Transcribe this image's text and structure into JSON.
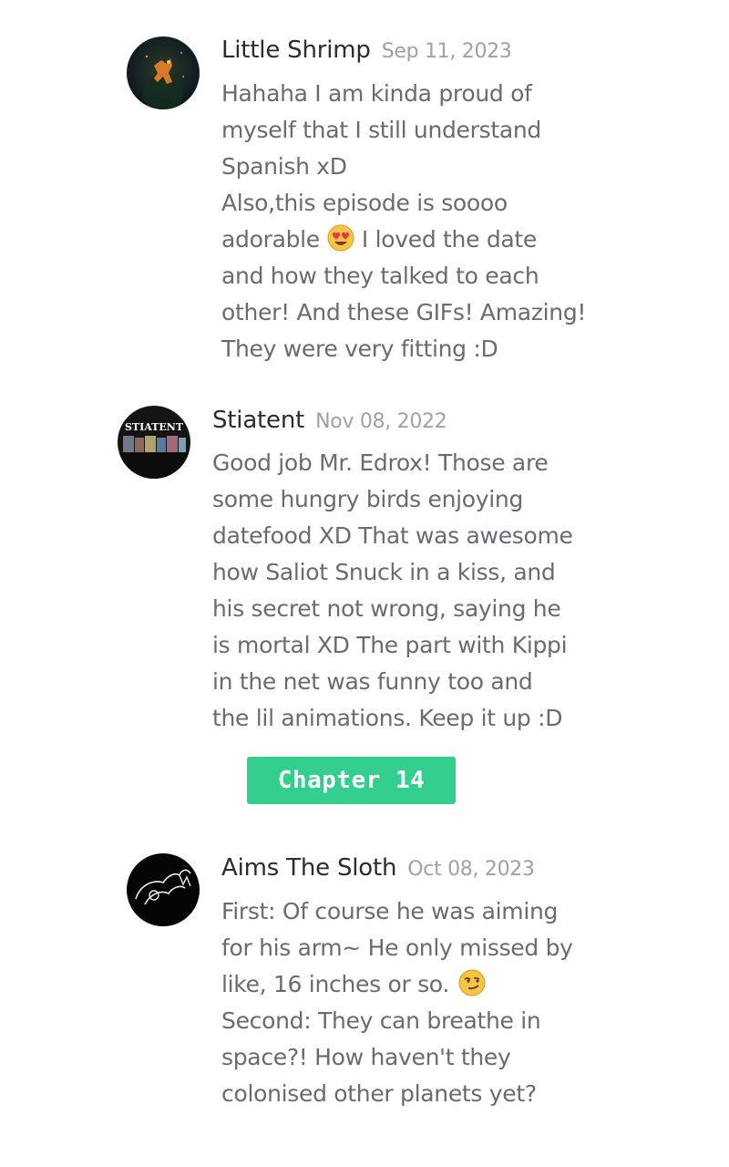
{
  "comments": [
    {
      "username": "Little Shrimp",
      "date": "Sep 11, 2023",
      "avatar_icon": "shrimp-avatar",
      "lines": [
        "Hahaha I am kinda proud of",
        "myself that I still understand",
        "Spanish xD",
        "Also,this episode is soooo",
        "adorable",
        "I loved the date",
        "and how they talked to each",
        "other! And these GIFs! Amazing!",
        "They were very fitting :D"
      ],
      "emoji": "heart-eyes-emoji"
    },
    {
      "username": "Stiatent",
      "date": "Nov 08, 2022",
      "avatar_text": "STIATENT",
      "lines": [
        "Good job Mr. Edrox! Those are",
        "some hungry birds enjoying",
        "datefood XD That was awesome",
        "how Saliot Snuck in a kiss, and",
        "his secret not wrong, saying he",
        "is mortal XD The part with Kippi",
        "in the net was funny too and",
        "the lil animations. Keep it up :D"
      ]
    },
    {
      "username": "Aims The Sloth",
      "date": "Oct 08, 2023",
      "avatar_icon": "sloth-avatar",
      "lines": [
        "First: Of course he was aiming",
        "for his arm~ He only missed by",
        "like, 16 inches or so.",
        "Second: They can breathe in",
        "space?! How haven't they",
        "colonised other planets yet?"
      ],
      "emoji": "smirk-emoji"
    }
  ],
  "chapter_button": {
    "label": "Chapter 14",
    "color": "#34cf8f"
  }
}
